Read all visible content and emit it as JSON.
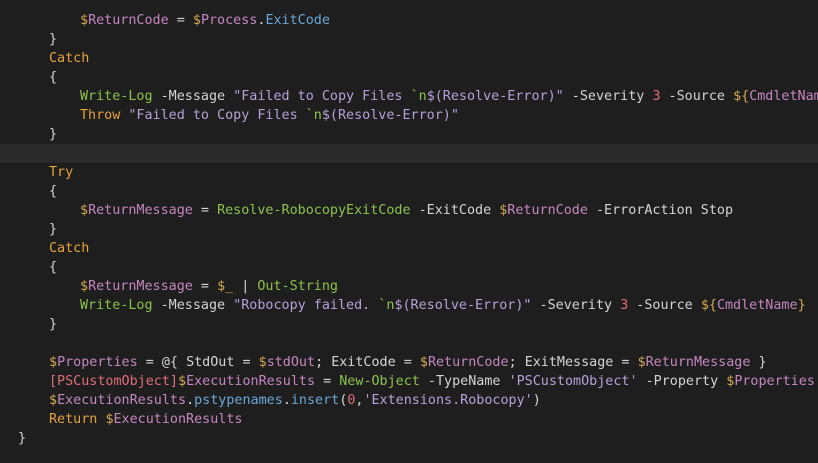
{
  "editor": {
    "lines": [
      {
        "indent": 2,
        "tokens": [
          {
            "t": "$",
            "c": "var-ink"
          },
          {
            "t": "ReturnCode",
            "c": "var"
          },
          {
            "t": " = ",
            "c": "op"
          },
          {
            "t": "$",
            "c": "var-ink"
          },
          {
            "t": "Process",
            "c": "var"
          },
          {
            "t": ".",
            "c": "op"
          },
          {
            "t": "ExitCode",
            "c": "prop"
          }
        ]
      },
      {
        "indent": 1,
        "tokens": [
          {
            "t": "}",
            "c": "brace"
          }
        ]
      },
      {
        "indent": 1,
        "tokens": [
          {
            "t": "Catch",
            "c": "kw"
          }
        ]
      },
      {
        "indent": 1,
        "tokens": [
          {
            "t": "{",
            "c": "brace"
          }
        ]
      },
      {
        "indent": 2,
        "tokens": [
          {
            "t": "Write-Log",
            "c": "cmd"
          },
          {
            "t": " -Message ",
            "c": "param"
          },
          {
            "t": "\"Failed to Copy Files ",
            "c": "str"
          },
          {
            "t": "`n",
            "c": "esc"
          },
          {
            "t": "$(Resolve-Error)\"",
            "c": "str"
          },
          {
            "t": " -Severity ",
            "c": "param"
          },
          {
            "t": "3",
            "c": "num"
          },
          {
            "t": " -Source ",
            "c": "param"
          },
          {
            "t": "${",
            "c": "var-ink"
          },
          {
            "t": "CmdletName",
            "c": "var"
          },
          {
            "t": "}",
            "c": "var-ink"
          }
        ]
      },
      {
        "indent": 2,
        "tokens": [
          {
            "t": "Throw",
            "c": "kw"
          },
          {
            "t": " ",
            "c": "plain"
          },
          {
            "t": "\"Failed to Copy Files ",
            "c": "str"
          },
          {
            "t": "`n",
            "c": "esc"
          },
          {
            "t": "$(Resolve-Error)\"",
            "c": "str"
          }
        ]
      },
      {
        "indent": 1,
        "tokens": [
          {
            "t": "}",
            "c": "brace"
          }
        ]
      },
      {
        "indent": 1,
        "current": true,
        "tokens": []
      },
      {
        "indent": 1,
        "tokens": [
          {
            "t": "Try",
            "c": "kw"
          }
        ]
      },
      {
        "indent": 1,
        "tokens": [
          {
            "t": "{",
            "c": "brace"
          }
        ]
      },
      {
        "indent": 2,
        "tokens": [
          {
            "t": "$",
            "c": "var-ink"
          },
          {
            "t": "ReturnMessage",
            "c": "var"
          },
          {
            "t": " = ",
            "c": "op"
          },
          {
            "t": "Resolve-RobocopyExitCode",
            "c": "cmd"
          },
          {
            "t": " -ExitCode ",
            "c": "param"
          },
          {
            "t": "$",
            "c": "var-ink"
          },
          {
            "t": "ReturnCode",
            "c": "var"
          },
          {
            "t": " -ErrorAction Stop",
            "c": "param"
          }
        ]
      },
      {
        "indent": 1,
        "tokens": [
          {
            "t": "}",
            "c": "brace"
          }
        ]
      },
      {
        "indent": 1,
        "tokens": [
          {
            "t": "Catch",
            "c": "kw"
          }
        ]
      },
      {
        "indent": 1,
        "tokens": [
          {
            "t": "{",
            "c": "brace"
          }
        ]
      },
      {
        "indent": 2,
        "tokens": [
          {
            "t": "$",
            "c": "var-ink"
          },
          {
            "t": "ReturnMessage",
            "c": "var"
          },
          {
            "t": " = ",
            "c": "op"
          },
          {
            "t": "$_",
            "c": "var-ink"
          },
          {
            "t": " | ",
            "c": "op"
          },
          {
            "t": "Out-String",
            "c": "cmd"
          }
        ]
      },
      {
        "indent": 2,
        "tokens": [
          {
            "t": "Write-Log",
            "c": "cmd"
          },
          {
            "t": " -Message ",
            "c": "param"
          },
          {
            "t": "\"Robocopy failed. ",
            "c": "str"
          },
          {
            "t": "`n",
            "c": "esc"
          },
          {
            "t": "$(Resolve-Error)\"",
            "c": "str"
          },
          {
            "t": " -Severity ",
            "c": "param"
          },
          {
            "t": "3",
            "c": "num"
          },
          {
            "t": " -Source ",
            "c": "param"
          },
          {
            "t": "${",
            "c": "var-ink"
          },
          {
            "t": "CmdletName",
            "c": "var"
          },
          {
            "t": "}",
            "c": "var-ink"
          }
        ]
      },
      {
        "indent": 1,
        "tokens": [
          {
            "t": "}",
            "c": "brace"
          }
        ]
      },
      {
        "indent": 1,
        "tokens": []
      },
      {
        "indent": 1,
        "tokens": [
          {
            "t": "$",
            "c": "var-ink"
          },
          {
            "t": "Properties",
            "c": "var"
          },
          {
            "t": " = @{ ",
            "c": "op"
          },
          {
            "t": "StdOut",
            "c": "plain"
          },
          {
            "t": " = ",
            "c": "op"
          },
          {
            "t": "$",
            "c": "var-ink"
          },
          {
            "t": "stdOut",
            "c": "var"
          },
          {
            "t": "; ",
            "c": "op"
          },
          {
            "t": "ExitCode",
            "c": "plain"
          },
          {
            "t": " = ",
            "c": "op"
          },
          {
            "t": "$",
            "c": "var-ink"
          },
          {
            "t": "ReturnCode",
            "c": "var"
          },
          {
            "t": "; ",
            "c": "op"
          },
          {
            "t": "ExitMessage",
            "c": "plain"
          },
          {
            "t": " = ",
            "c": "op"
          },
          {
            "t": "$",
            "c": "var-ink"
          },
          {
            "t": "ReturnMessage",
            "c": "var"
          },
          {
            "t": " }",
            "c": "op"
          }
        ]
      },
      {
        "indent": 1,
        "tokens": [
          {
            "t": "[PSCustomObject]",
            "c": "type"
          },
          {
            "t": "$",
            "c": "var-ink"
          },
          {
            "t": "ExecutionResults",
            "c": "var"
          },
          {
            "t": " = ",
            "c": "op"
          },
          {
            "t": "New-Object",
            "c": "cmd"
          },
          {
            "t": " -TypeName ",
            "c": "param"
          },
          {
            "t": "'PSCustomObject'",
            "c": "str"
          },
          {
            "t": " -Property ",
            "c": "param"
          },
          {
            "t": "$",
            "c": "var-ink"
          },
          {
            "t": "Properties",
            "c": "var"
          }
        ]
      },
      {
        "indent": 1,
        "tokens": [
          {
            "t": "$",
            "c": "var-ink"
          },
          {
            "t": "ExecutionResults",
            "c": "var"
          },
          {
            "t": ".",
            "c": "op"
          },
          {
            "t": "pstypenames",
            "c": "prop"
          },
          {
            "t": ".",
            "c": "op"
          },
          {
            "t": "insert",
            "c": "prop"
          },
          {
            "t": "(",
            "c": "op"
          },
          {
            "t": "0",
            "c": "num"
          },
          {
            "t": ",",
            "c": "op"
          },
          {
            "t": "'Extensions.Robocopy'",
            "c": "str"
          },
          {
            "t": ")",
            "c": "op"
          }
        ]
      },
      {
        "indent": 1,
        "tokens": [
          {
            "t": "Return",
            "c": "kw"
          },
          {
            "t": " ",
            "c": "plain"
          },
          {
            "t": "$",
            "c": "var-ink"
          },
          {
            "t": "ExecutionResults",
            "c": "var"
          }
        ]
      },
      {
        "indent": 0,
        "tokens": [
          {
            "t": "}",
            "c": "brace"
          }
        ]
      }
    ]
  }
}
